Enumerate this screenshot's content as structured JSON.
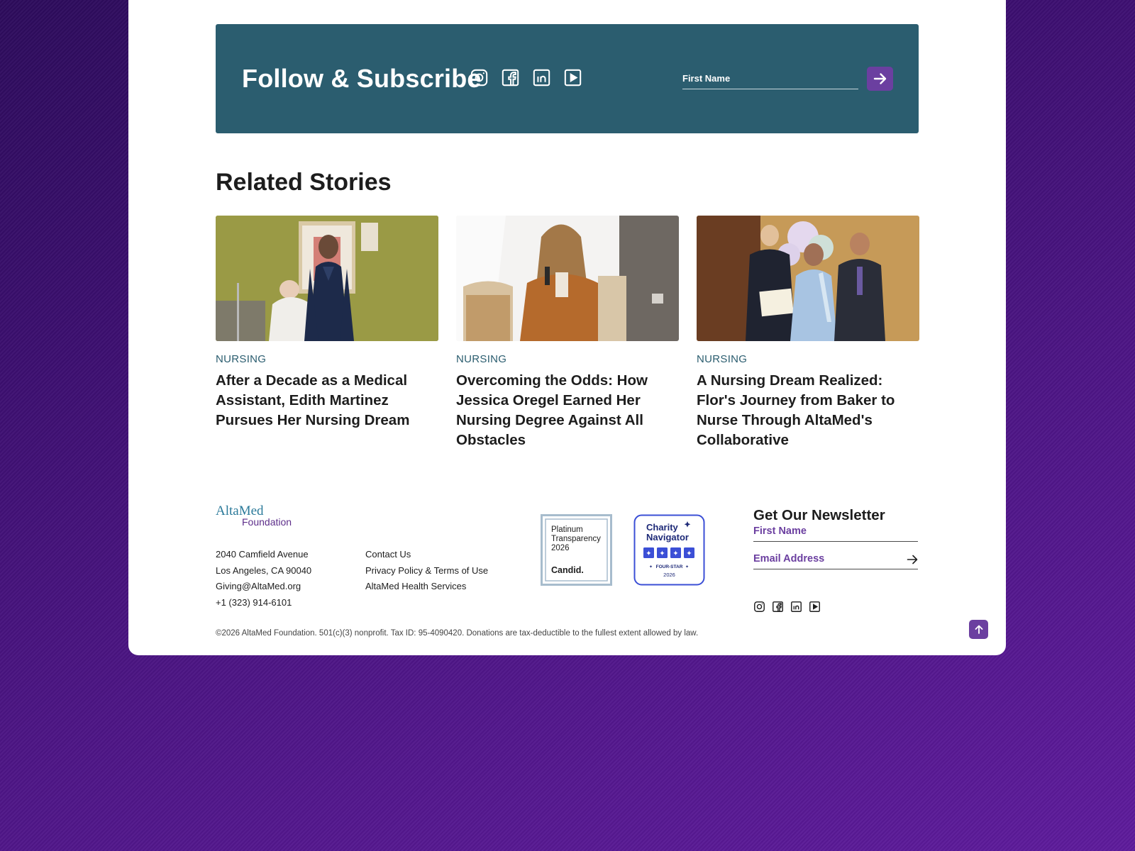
{
  "subscribe": {
    "title": "Follow & Subscribe",
    "first_name_placeholder": "First Name"
  },
  "social_icons": [
    "instagram-icon",
    "facebook-icon",
    "linkedin-icon",
    "youtube-icon"
  ],
  "related": {
    "title": "Related Stories",
    "stories": [
      {
        "category": "NURSING",
        "headline": "After a Decade as a Medical Assistant, Edith Martinez Pursues Her Nursing Dream"
      },
      {
        "category": "NURSING",
        "headline": "Overcoming the Odds: How Jessica Oregel Earned Her Nursing Degree Against All Obstacles"
      },
      {
        "category": "NURSING",
        "headline": "A Nursing Dream Realized: Flor's Journey from Baker to Nurse Through AltaMed's Collaborative"
      }
    ]
  },
  "footer": {
    "logo": {
      "line1": "AltaMed",
      "line2": "Foundation"
    },
    "address": [
      "2040 Camfield Avenue",
      "Los Angeles, CA 90040",
      "Giving@AltaMed.org",
      "+1 (323) 914-6101"
    ],
    "links": [
      "Contact Us",
      "Privacy Policy & Terms of Use",
      "AltaMed Health Services"
    ],
    "candid_badge": {
      "line1": "Platinum",
      "line2": "Transparency",
      "year": "2026",
      "brand": "Candid."
    },
    "charity_badge": {
      "line1": "Charity",
      "line2": "Navigator",
      "rating": "FOUR-STAR",
      "year": "2026"
    },
    "newsletter": {
      "title": "Get Our Newsletter",
      "first_name_placeholder": "First Name",
      "email_placeholder": "Email Address"
    },
    "copyright": "©2026 AltaMed Foundation. 501(c)(3) nonprofit. Tax ID: 95-4090420. Donations are tax-deductible to the fullest extent allowed by law."
  },
  "colors": {
    "banner": "#2b5d6f",
    "accent": "#6b3fa0",
    "background": "#4a1580"
  }
}
